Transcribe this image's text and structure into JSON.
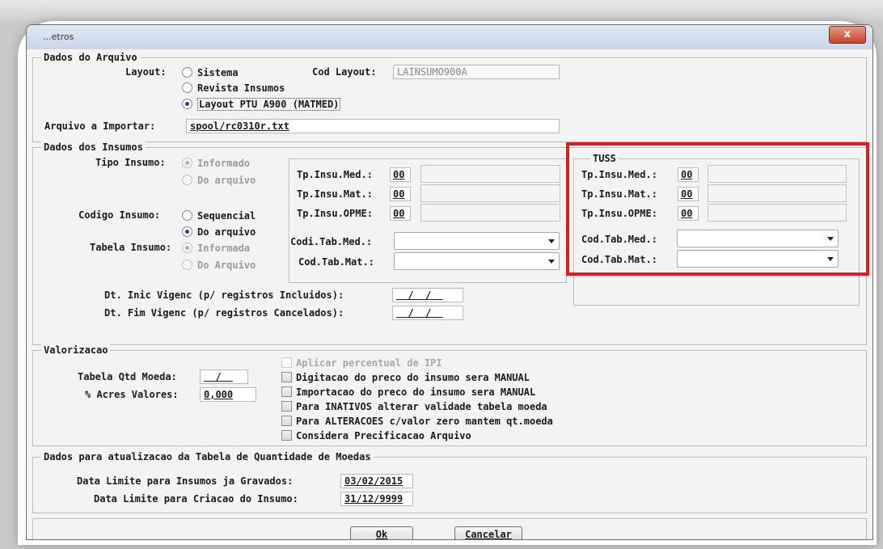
{
  "window": {
    "title": "...etros",
    "close_glyph": "x"
  },
  "arquivo": {
    "legend": "Dados do Arquivo",
    "layout_label": "Layout:",
    "layout_options": [
      "Sistema",
      "Revista Insumos",
      "Layout PTU A900 (MATMED)"
    ],
    "layout_selected": "Layout PTU A900 (MATMED)",
    "cod_layout_label": "Cod Layout:",
    "cod_layout_value": "LAINSUMO900A",
    "arquivo_label": "Arquivo a Importar:",
    "arquivo_value": "spool/rc0310r.txt"
  },
  "insumos": {
    "legend": "Dados dos Insumos",
    "tipo_label": "Tipo Insumo:",
    "tipo_options": [
      "Informado",
      "Do arquivo"
    ],
    "codigo_label": "Codigo Insumo:",
    "codigo_options": [
      "Sequencial",
      "Do arquivo"
    ],
    "tabela_label": "Tabela Insumo:",
    "tabela_options": [
      "Informada",
      "Do Arquivo"
    ],
    "tp_med_label": "Tp.Insu.Med.:",
    "tp_med_value": "00",
    "tp_mat_label": "Tp.Insu.Mat.:",
    "tp_mat_value": "00",
    "tp_opme_label": "Tp.Insu.OPME:",
    "tp_opme_value": "00",
    "codi_tab_med_label": "Codi.Tab.Med.:",
    "cod_tab_mat_label": "Cod.Tab.Mat.:",
    "dt_inic_label": "Dt. Inic Vigenc (p/ registros Incluidos):",
    "dt_inic_value": "  /  /  ",
    "dt_fim_label": "Dt. Fim Vigenc (p/ registros Cancelados):",
    "dt_fim_value": "  /  /  "
  },
  "tuss": {
    "legend": "TUSS",
    "tp_med_label": "Tp.Insu.Med.:",
    "tp_med_value": "00",
    "tp_mat_label": "Tp.Insu.Mat.:",
    "tp_mat_value": "00",
    "tp_opme_label": "Tp.Insu.OPME:",
    "tp_opme_value": "00",
    "cod_tab_med_label": "Cod.Tab.Med.:",
    "cod_tab_mat_label": "Cod.Tab.Mat.:"
  },
  "valorizacao": {
    "legend": "Valorizacao",
    "tabela_label": "Tabela Qtd Moeda:",
    "tabela_value": "  /  ",
    "acres_label": "% Acres Valores:",
    "acres_value": "0,000",
    "checks": [
      "Aplicar percentual de IPI",
      "Digitacao do preco do insumo sera MANUAL",
      "Importacao do preco do insumo sera MANUAL",
      "Para INATIVOS alterar validade tabela moeda",
      "Para ALTERACOES c/valor zero mantem qt.moeda",
      "Considera Precificacao Arquivo"
    ]
  },
  "atualizacao": {
    "legend": "Dados para atualizacao da Tabela de Quantidade de Moedas",
    "limite_gravados_label": "Data Limite para Insumos ja Gravados:",
    "limite_gravados_value": "03/02/2015",
    "limite_criacao_label": "Data Limite para Criacao do Insumo:",
    "limite_criacao_value": "31/12/9999"
  },
  "buttons": {
    "ok": "Ok",
    "cancelar": "Cancelar"
  },
  "colors": {
    "highlight": "#e21b1b"
  }
}
